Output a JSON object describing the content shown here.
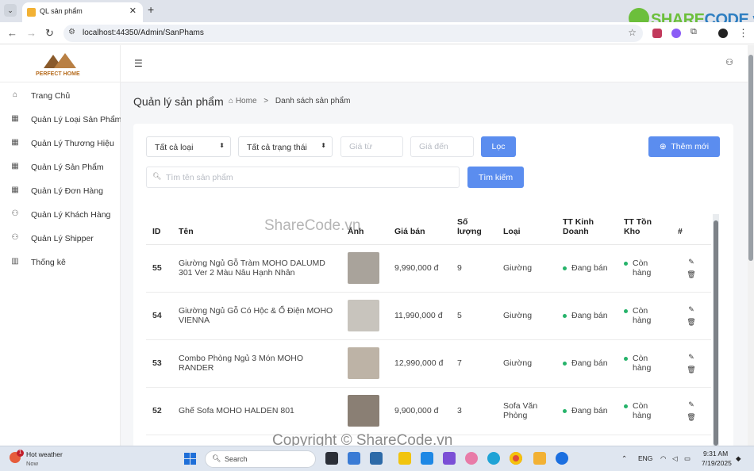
{
  "browser": {
    "tab_title": "QL sản phẩm",
    "url": "localhost:44350/Admin/SanPhams",
    "brand_part1": "SHARE",
    "brand_part2": "CODE.vn"
  },
  "logo": {
    "text": "PERFECT HOME"
  },
  "sidebar": {
    "items": [
      {
        "label": "Trang Chủ",
        "icon": "home-icon",
        "glyph": "⌂"
      },
      {
        "label": "Quản Lý Loại Sản Phẩm",
        "icon": "grid-icon",
        "glyph": "▦"
      },
      {
        "label": "Quản Lý Thương Hiệu",
        "icon": "grid-icon",
        "glyph": "▦"
      },
      {
        "label": "Quản Lý Sản Phẩm",
        "icon": "grid-icon",
        "glyph": "▦"
      },
      {
        "label": "Quản Lý Đơn Hàng",
        "icon": "grid-icon",
        "glyph": "▦"
      },
      {
        "label": "Quản Lý Khách Hàng",
        "icon": "user-icon",
        "glyph": "⚇"
      },
      {
        "label": "Quản Lý Shipper",
        "icon": "user-icon",
        "glyph": "⚇"
      },
      {
        "label": "Thống kê",
        "icon": "chart-icon",
        "glyph": "▥"
      }
    ]
  },
  "page": {
    "title": "Quản lý sản phẩm",
    "breadcrumb_home": "Home",
    "breadcrumb_sep": ">",
    "breadcrumb_current": "Danh sách sản phẩm"
  },
  "filters": {
    "category": "Tất cả loại",
    "status": "Tất cả trạng thái",
    "price_from_placeholder": "Giá từ",
    "price_to_placeholder": "Giá đến",
    "filter_button": "Lọc",
    "add_button": "Thêm mới",
    "search_placeholder": "Tìm tên sản phẩm",
    "search_button": "Tìm kiếm"
  },
  "table": {
    "headers": {
      "id": "ID",
      "name": "Tên",
      "image": "Ảnh",
      "price": "Giá bán",
      "qty": "Số lượng",
      "category": "Loại",
      "biz_status": "TT Kinh Doanh",
      "stock_status": "TT Tồn Kho",
      "actions": "#"
    },
    "rows": [
      {
        "id": "55",
        "name": "Giường Ngủ Gỗ Tràm MOHO DALUMD 301 Ver 2 Màu Nâu Hạnh Nhân",
        "price": "9,990,000 đ",
        "qty": "9",
        "category": "Giường",
        "biz_status": "Đang bán",
        "stock_status": "Còn hàng",
        "thumb_color": "#a9a39b"
      },
      {
        "id": "54",
        "name": "Giường Ngủ Gỗ Có Hộc & Ổ Điện MOHO VIENNA",
        "price": "11,990,000 đ",
        "qty": "5",
        "category": "Giường",
        "biz_status": "Đang bán",
        "stock_status": "Còn hàng",
        "thumb_color": "#c8c4bd"
      },
      {
        "id": "53",
        "name": "Combo Phòng Ngủ 3 Món MOHO RANDER",
        "price": "12,990,000 đ",
        "qty": "7",
        "category": "Giường",
        "biz_status": "Đang bán",
        "stock_status": "Còn hàng",
        "thumb_color": "#bdb3a6"
      },
      {
        "id": "52",
        "name": "Ghế Sofa MOHO HALDEN 801",
        "price": "9,900,000 đ",
        "qty": "3",
        "category": "Sofa Văn Phòng",
        "biz_status": "Đang bán",
        "stock_status": "Còn hàng",
        "thumb_color": "#8a7f74"
      }
    ]
  },
  "watermark": "ShareCode.vn",
  "copyright": "Copyright © ShareCode.vn",
  "taskbar": {
    "weather_title": "Hot weather",
    "weather_sub": "Now",
    "weather_badge": "1",
    "search": "Search",
    "lang": "ENG",
    "time": "9:31 AM",
    "date": "7/19/2025"
  }
}
